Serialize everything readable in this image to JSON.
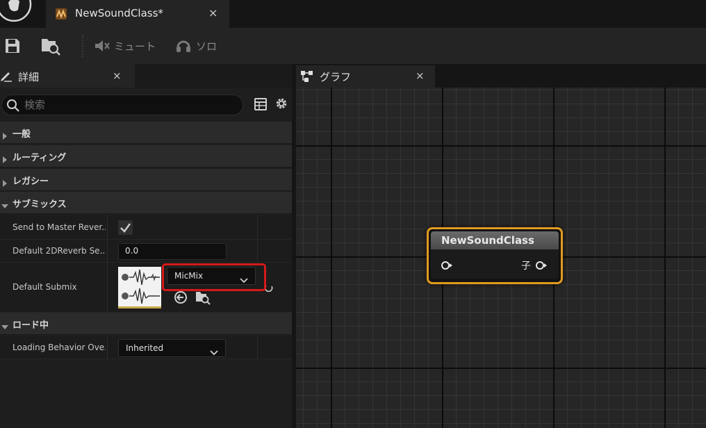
{
  "document_tab": {
    "title": "NewSoundClass*",
    "close_glyph": "×"
  },
  "toolbar": {
    "save_icon": "save-icon",
    "browse_icon": "browse-asset-icon",
    "mute_label": "ミュート",
    "solo_label": "ソロ"
  },
  "details": {
    "tab_label": "詳細",
    "close_glyph": "×",
    "search_placeholder": "検索",
    "categories": [
      {
        "label": "一般",
        "expanded": false
      },
      {
        "label": "ルーティング",
        "expanded": false
      },
      {
        "label": "レガシー",
        "expanded": false
      },
      {
        "label": "サブミックス",
        "expanded": true
      },
      {
        "label": "ロード中",
        "expanded": true
      }
    ],
    "submix": {
      "send_to_master_reverb": {
        "label": "Send to Master Rever...",
        "checked": true
      },
      "default_2d_reverb_send": {
        "label": "Default 2DReverb Se...",
        "value": "0.0"
      },
      "default_submix": {
        "label": "Default Submix",
        "selected": "MicMix"
      }
    },
    "loading": {
      "loading_behavior_override": {
        "label": "Loading Behavior Ove...",
        "selected": "Inherited"
      }
    }
  },
  "graph": {
    "tab_label": "グラフ",
    "close_glyph": "×",
    "node": {
      "title": "NewSoundClass",
      "output_pin_label": "子"
    }
  },
  "colors": {
    "node_border": "#e29a1e",
    "highlight": "#d71919",
    "panel_bg": "#1e1e1e"
  }
}
